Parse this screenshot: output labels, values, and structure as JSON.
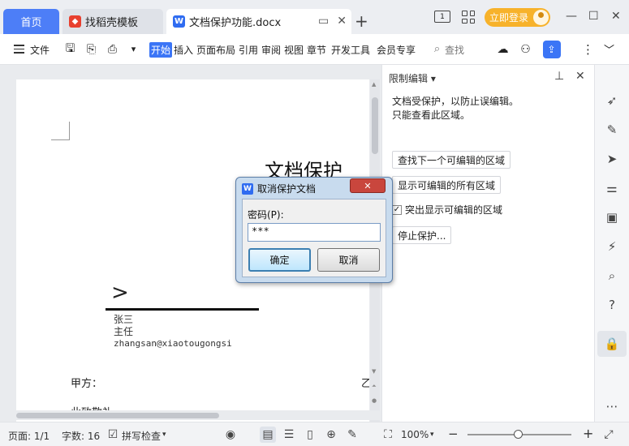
{
  "tabs": {
    "home": "首页",
    "template_tab": "找稻壳模板",
    "doc_tab": "文档保护功能.docx",
    "add": "+"
  },
  "titlebar": {
    "login": "立即登录",
    "icons": [
      "split-view-icon",
      "apps-grid-icon",
      "minimize-icon",
      "restore-icon",
      "close-icon"
    ]
  },
  "ribbon": {
    "file": "文件",
    "menus": [
      "开始",
      "插入",
      "页面布局",
      "引用",
      "审阅",
      "视图",
      "章节",
      "开发工具",
      "会员专享"
    ],
    "search": "查找",
    "accent_color": "#3b75f6"
  },
  "document": {
    "heading": "文档保护",
    "chevron": ">",
    "sig_name": "张三",
    "sig_title": "主任",
    "sig_email": "zhangsan@xiaotougongsi",
    "party_a": "甲方：",
    "party_b": "乙",
    "closing": "此致敬礼"
  },
  "panel": {
    "title": "限制编辑",
    "title_arrow": "▾",
    "desc_line1": "文档受保护，以防止误编辑。",
    "desc_line2": "只能查看此区域。",
    "btn_next": "查找下一个可编辑的区域",
    "btn_show_all": "显示可编辑的所有区域",
    "check_highlight": "突出显示可编辑的区域",
    "check_highlight_checked": true,
    "btn_stop": "停止保护..."
  },
  "dialog": {
    "title": "取消保护文档",
    "label": "密码(P):",
    "password_value": "***",
    "ok": "确定",
    "cancel": "取消"
  },
  "statusbar": {
    "page": "页面: 1/1",
    "words": "字数: 16",
    "spellcheck": "拼写检查",
    "spell_arrow": "▾",
    "zoom": "100%",
    "zoom_arrow": "▾",
    "minus": "−",
    "plus": "+"
  }
}
